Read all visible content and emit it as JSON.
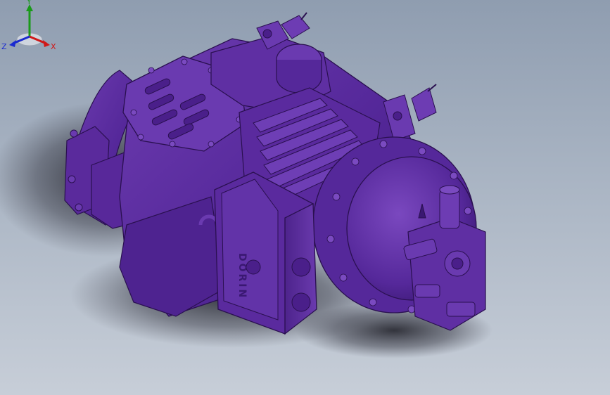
{
  "viewport": {
    "background_top": "#8f9db0",
    "background_bottom": "#c7ced8"
  },
  "model": {
    "name": "compressor-model",
    "color": "#5b2a99",
    "logo_text": "DORIN"
  },
  "triad": {
    "x_label": "X",
    "y_label": "Y",
    "z_label": "Z",
    "x_color": "#d01818",
    "y_color": "#1a9a1a",
    "z_color": "#1a2ad0"
  }
}
